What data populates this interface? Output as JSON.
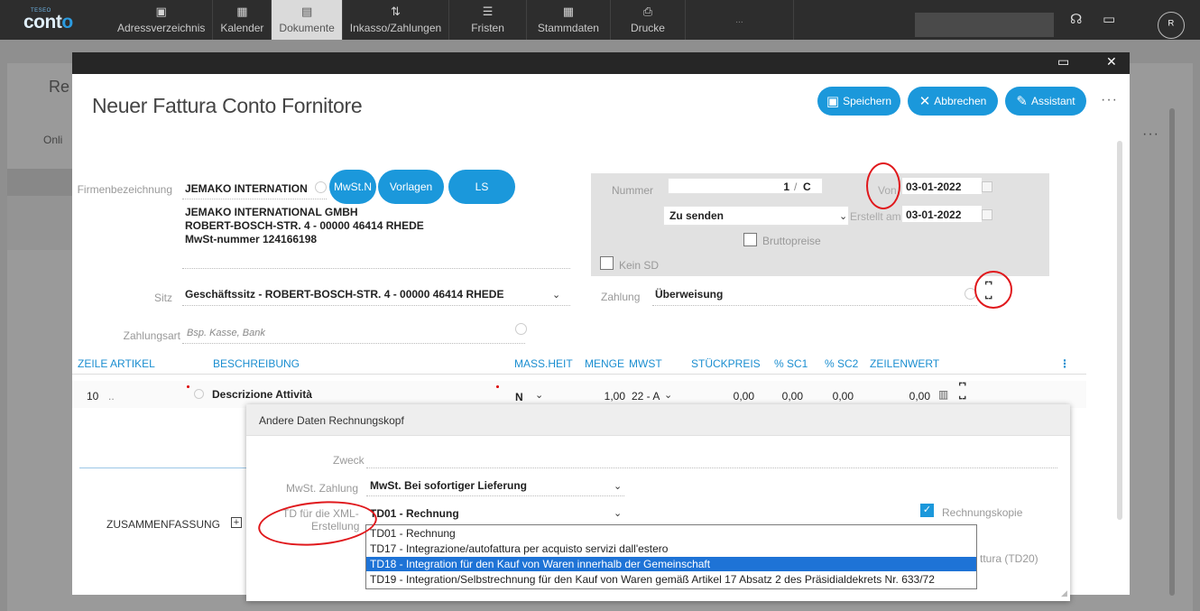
{
  "topbar": {
    "logo_small": "TESEO",
    "logo_text": "cont",
    "logo_accent": "o",
    "nav": [
      {
        "label": "Adressverzeichnis",
        "icon": "address-book-icon",
        "glyph": "▣"
      },
      {
        "label": "Kalender",
        "icon": "calendar-icon",
        "glyph": "▦"
      },
      {
        "label": "Dokumente",
        "icon": "document-icon",
        "glyph": "▤"
      },
      {
        "label": "Inkasso/Zahlungen",
        "icon": "transfer-arrows-icon",
        "glyph": "⇅"
      },
      {
        "label": "Fristen",
        "icon": "list-icon",
        "glyph": "☰"
      },
      {
        "label": "Stammdaten",
        "icon": "grid-icon",
        "glyph": "▦"
      },
      {
        "label": "Drucke",
        "icon": "printer-icon",
        "glyph": "⎙"
      }
    ],
    "more": "..."
  },
  "background": {
    "title_fragment": "Re",
    "online_fragment": "Onli"
  },
  "form": {
    "title": "Neuer Fattura Conto Fornitore",
    "save": "Speichern",
    "cancel": "Abbrechen",
    "assistant": "Assistant",
    "more": "···",
    "firm_label": "Firmenbezeichnung",
    "firm_value": "JEMAKO INTERNATION",
    "btn_mwst": "MwSt.N",
    "btn_vorlagen": "Vorlagen",
    "btn_ls": "LS",
    "addr_line1": "JEMAKO INTERNATIONAL GMBH",
    "addr_line2": "ROBERT-BOSCH-STR. 4 - 00000 46414 RHEDE",
    "addr_line3": "MwSt-nummer 124166198",
    "nummer_label": "Nummer",
    "nummer_value": "1",
    "nummer_sep": "/",
    "nummer_suffix": "C",
    "von_label": "Von",
    "von_value": "03-01-2022",
    "status_value": "Zu senden",
    "erstellt_label": "Erstellt am",
    "erstellt_value": "03-01-2022",
    "brutto_label": "Bruttopreise",
    "keinsd_label": "Kein SD",
    "sitz_label": "Sitz",
    "sitz_value": "Geschäftssitz - ROBERT-BOSCH-STR. 4 - 00000 46414 RHEDE",
    "zahlung_label": "Zahlung",
    "zahlung_value": "Überweisung",
    "zahlungsart_label": "Zahlungsart",
    "zahlungsart_placeholder": "Bsp. Kasse, Bank"
  },
  "table": {
    "headers": [
      "ZEILE ARTIKEL",
      "BESCHREIBUNG",
      "MASS.HEIT",
      "MENGE",
      "MWST",
      "STÜCKPREIS",
      "% SC1",
      "% SC2",
      "ZEILENWERT"
    ],
    "row": {
      "zeile": "10",
      "artikel": "..",
      "beschreibung": "Descrizione Attività",
      "massheit": "N",
      "menge": "1,00",
      "mwst": "22 - A",
      "stueckpreis": "0,00",
      "sc1": "0,00",
      "sc2": "0,00",
      "zeilenwert": "0,00"
    },
    "summary_label": "ZUSAMMENFASSUNG"
  },
  "popup": {
    "title": "Andere Daten Rechnungskopf",
    "zweck_label": "Zweck",
    "mwst_zahlung_label": "MwSt. Zahlung",
    "mwst_zahlung_value": "MwSt. Bei sofortiger Lieferung",
    "td_label_1": "TD für die XML-",
    "td_label_2": "Erstellung",
    "td_value": "TD01 - Rechnung",
    "rechnungskopie_label": "Rechnungskopie",
    "td20_fragment": "ttura (TD20)",
    "options": [
      "TD01 - Rechnung",
      "TD17 - Integrazione/autofattura per acquisto servizi dall'estero",
      "TD18 - Integration für den Kauf von Waren innerhalb der Gemeinschaft",
      "TD19 - Integration/Selbstrechnung für den Kauf von Waren gemäß Artikel 17 Absatz 2 des Präsidialdekrets Nr. 633/72"
    ],
    "selected_index": 2
  },
  "colors": {
    "accent": "#1b98db",
    "topbar": "#2d2d2d",
    "highlight": "#1e73d6",
    "annotation": "#e0181c"
  }
}
